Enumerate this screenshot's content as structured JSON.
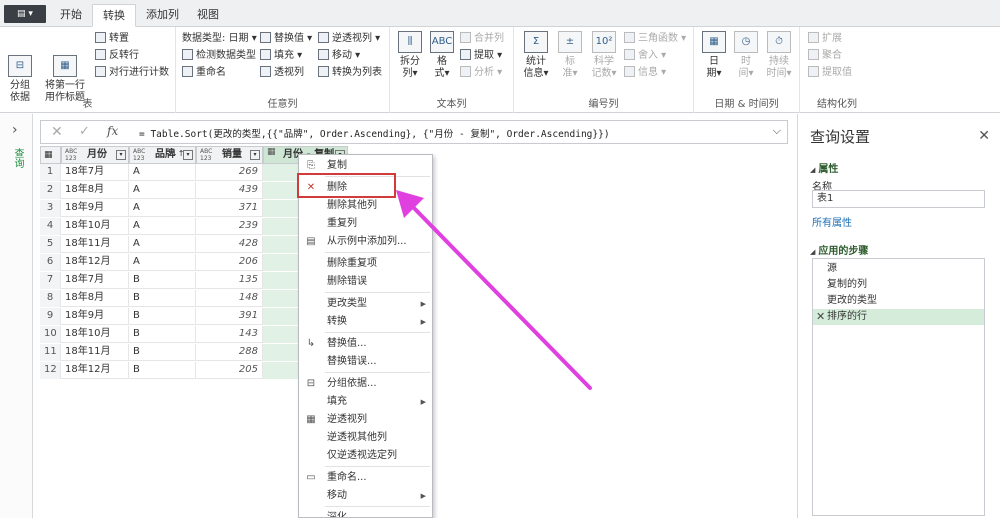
{
  "tabs": {
    "file": "▤ ▾",
    "items": [
      "开始",
      "转换",
      "添加列",
      "视图"
    ]
  },
  "ribbon": {
    "table_group": {
      "label": "表",
      "group_by": "分组\n依据",
      "use_first_row": "将第一行\n用作标题",
      "transpose": "转置",
      "reverse_rows": "反转行",
      "count_rows": "对行进行计数"
    },
    "any_column_group": {
      "label": "任意列",
      "data_type": "数据类型: 日期 ▾",
      "detect_type": "检测数据类型",
      "rename": "重命名",
      "replace_values": "替换值 ▾",
      "fill": "填充 ▾",
      "pivot": "透视列",
      "unpivot": "逆透视列 ▾",
      "move": "移动 ▾",
      "to_list": "转换为列表"
    },
    "text_group": {
      "label": "文本列",
      "split": "拆分\n列▾",
      "format": "格\n式▾",
      "merge": "合并列",
      "extract": "提取 ▾",
      "parse": "分析 ▾"
    },
    "number_group": {
      "label": "编号列",
      "statistics": "统计\n信息▾",
      "standard": "标\n准▾",
      "scientific": "科学\n记数▾",
      "trig": "三角函数 ▾",
      "rounding": "舍入 ▾",
      "info": "信息 ▾"
    },
    "datetime_group": {
      "label": "日期 & 时间列",
      "date": "日\n期▾",
      "time": "时\n间▾",
      "duration": "持续\n时间▾"
    },
    "structured_group": {
      "label": "结构化列",
      "expand": "扩展",
      "aggregate": "聚合",
      "extract_values": "提取值"
    }
  },
  "query_nav": {
    "vertical_label": "查询"
  },
  "formula_bar": {
    "formula": "= Table.Sort(更改的类型,{{\"品牌\", Order.Ascending}, {\"月份 - 复制\", Order.Ascending}})"
  },
  "grid": {
    "columns": [
      {
        "type": "ABC\n123",
        "name": "月份"
      },
      {
        "type": "ABC\n123",
        "name": "品牌"
      },
      {
        "type": "ABC\n123",
        "name": "销量"
      },
      {
        "type": "▦",
        "name": "月份 - 复制"
      }
    ],
    "rows": [
      [
        "1",
        "18年7月",
        "A",
        "269"
      ],
      [
        "2",
        "18年8月",
        "A",
        "439"
      ],
      [
        "3",
        "18年9月",
        "A",
        "371"
      ],
      [
        "4",
        "18年10月",
        "A",
        "239"
      ],
      [
        "5",
        "18年11月",
        "A",
        "428"
      ],
      [
        "6",
        "18年12月",
        "A",
        "206"
      ],
      [
        "7",
        "18年7月",
        "B",
        "135"
      ],
      [
        "8",
        "18年8月",
        "B",
        "148"
      ],
      [
        "9",
        "18年9月",
        "B",
        "391"
      ],
      [
        "10",
        "18年10月",
        "B",
        "143"
      ],
      [
        "11",
        "18年11月",
        "B",
        "288"
      ],
      [
        "12",
        "18年12月",
        "B",
        "205"
      ]
    ]
  },
  "context_menu": {
    "items": [
      "复制",
      "删除",
      "删除其他列",
      "重复列",
      "从示例中添加列...",
      "删除重复项",
      "删除错误",
      "更改类型",
      "转换",
      "替换值...",
      "替换错误...",
      "分组依据...",
      "填充",
      "逆透视列",
      "逆透视其他列",
      "仅逆透视选定列",
      "重命名...",
      "移动",
      "深化"
    ]
  },
  "query_settings": {
    "title": "查询设置",
    "properties_header": "属性",
    "name_label": "名称",
    "name_value": "表1",
    "all_properties_link": "所有属性",
    "steps_header": "应用的步骤",
    "steps": [
      "源",
      "复制的列",
      "更改的类型",
      "排序的行"
    ]
  },
  "colors": {
    "accent_green": "#1e8e3e",
    "highlight_red": "#d23b3b",
    "arrow_magenta": "#e040e0",
    "selected_column": "#e2f1e6"
  }
}
